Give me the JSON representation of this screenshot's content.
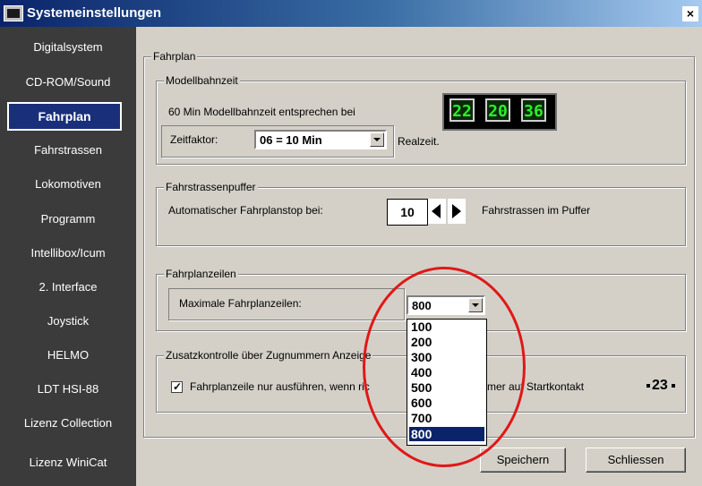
{
  "window": {
    "title": "Systemeinstellungen",
    "close": "×"
  },
  "sidebar": {
    "items": [
      {
        "label": "Digitalsystem"
      },
      {
        "label": "CD-ROM/Sound"
      },
      {
        "label": "Fahrplan",
        "active": true
      },
      {
        "label": "Fahrstrassen"
      },
      {
        "label": "Lokomotiven"
      },
      {
        "label": "Programm"
      },
      {
        "label": "Intellibox/Icum"
      },
      {
        "label": "2. Interface"
      },
      {
        "label": "Joystick"
      },
      {
        "label": "HELMO"
      },
      {
        "label": "LDT HSI-88"
      },
      {
        "label": "Lizenz Collection"
      },
      {
        "label": "Lizenz WiniCat"
      }
    ]
  },
  "fahrplan": {
    "title": "Fahrplan",
    "modellbahnzeit": {
      "title": "Modellbahnzeit",
      "text": "60 Min Modellbahnzeit entsprechen bei",
      "zeitfaktor_label": "Zeitfaktor:",
      "zeitfaktor_value": "06 = 10 Min",
      "realzeit": "Realzeit.",
      "clock": [
        "22",
        "20",
        "36"
      ]
    },
    "puffer": {
      "title": "Fahrstrassenpuffer",
      "label": "Automatischer Fahrplanstop bei:",
      "value": "10",
      "suffix": "Fahrstrassen im Puffer"
    },
    "zeilen": {
      "title": "Fahrplanzeilen",
      "label": "Maximale Fahrplanzeilen:",
      "value": "800",
      "options": [
        "100",
        "200",
        "300",
        "400",
        "500",
        "600",
        "700",
        "800"
      ]
    },
    "zusatz": {
      "title": "Zusatzkontrolle über Zugnummern Anzeige",
      "check_text_a": "Fahrplanzeile nur ausführen, wenn ric",
      "check_text_b": "mer auf Startkontakt",
      "badge": "23"
    }
  },
  "buttons": {
    "save": "Speichern",
    "close": "Schliessen"
  },
  "colors": {
    "title_start": "#0a246a",
    "sidebar_bg": "#3b3b3b",
    "active_item": "#1a2f7a",
    "highlight_ellipse": "#e01818",
    "digit": "#29f229"
  }
}
